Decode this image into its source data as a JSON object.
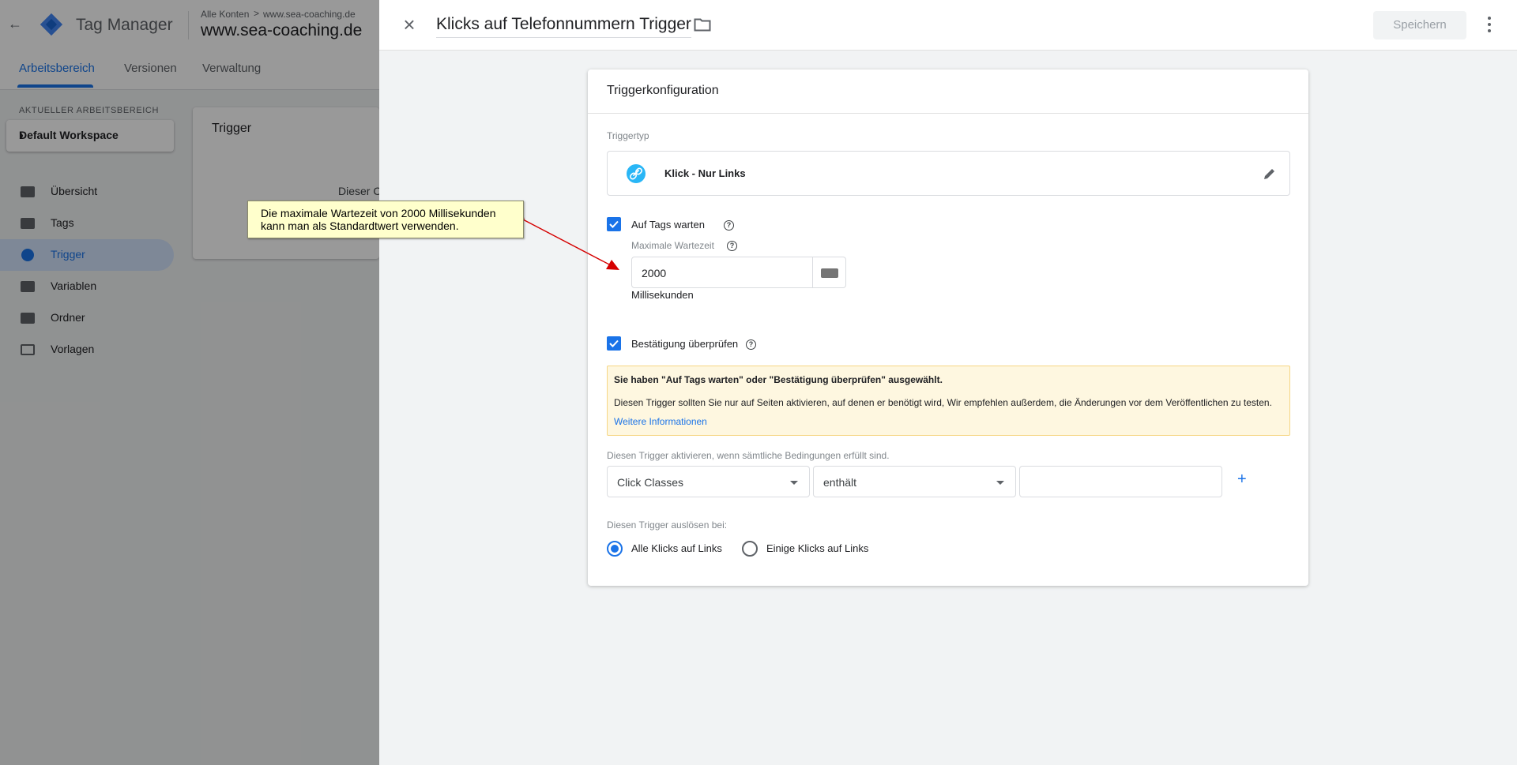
{
  "background_app": {
    "back_arrow": "←",
    "app_name": "Tag Manager",
    "breadcrumb_root": "Alle Konten",
    "breadcrumb_sep": ">",
    "breadcrumb_account": "www.sea-coaching.de",
    "container_name": "www.sea-coaching.de",
    "tabs": [
      "Arbeitsbereich",
      "Versionen",
      "Verwaltung"
    ],
    "active_tab": "Arbeitsbereich",
    "workspace_label": "AKTUELLER ARBEITSBEREICH",
    "workspace_name": "Default Workspace",
    "nav": [
      "Übersicht",
      "Tags",
      "Trigger",
      "Variablen",
      "Ordner",
      "Vorlagen"
    ],
    "active_nav": "Trigger",
    "card_title": "Trigger",
    "card_text": "Dieser C"
  },
  "panel": {
    "title": "Klicks auf Telefonnummern Trigger",
    "save_label": "Speichern"
  },
  "config": {
    "card_title": "Triggerkonfiguration",
    "trigger_type_label": "Triggertyp",
    "trigger_type": "Klick - Nur Links",
    "wait_for_tags_label": "Auf Tags warten",
    "wait_for_tags_checked": true,
    "max_wait_label": "Maximale Wartezeit",
    "max_wait_value": "2000",
    "max_wait_unit": "Millisekunden",
    "check_validation_label": "Bestätigung überprüfen",
    "check_validation_checked": true,
    "warning_title": "Sie haben \"Auf Tags warten\" oder \"Bestätigung überprüfen\" ausgewählt.",
    "warning_text": "Diesen Trigger sollten Sie nur auf Seiten aktivieren, auf denen er benötigt wird, Wir empfehlen außerdem, die Änderungen vor dem Veröffentlichen zu testen.",
    "warning_link": "Weitere Informationen",
    "enable_when_label": "Diesen Trigger aktivieren, wenn sämtliche Bedingungen erfüllt sind.",
    "condition_variable": "Click Classes",
    "condition_operator": "enthält",
    "condition_value": "",
    "add_condition": "+",
    "fire_on_label": "Diesen Trigger auslösen bei:",
    "fire_on_options": [
      "Alle Klicks auf Links",
      "Einige Klicks auf Links"
    ],
    "fire_on_selected": "Alle Klicks auf Links"
  },
  "annotation": {
    "callout_text": "Die maximale Wartezeit von 2000 Millisekunden kann man als Standardtwert verwenden."
  },
  "colors": {
    "accent": "#1a73e8",
    "warning_bg": "#fef7e0",
    "callout_bg": "#ffffcc",
    "arrow": "#d50000"
  }
}
